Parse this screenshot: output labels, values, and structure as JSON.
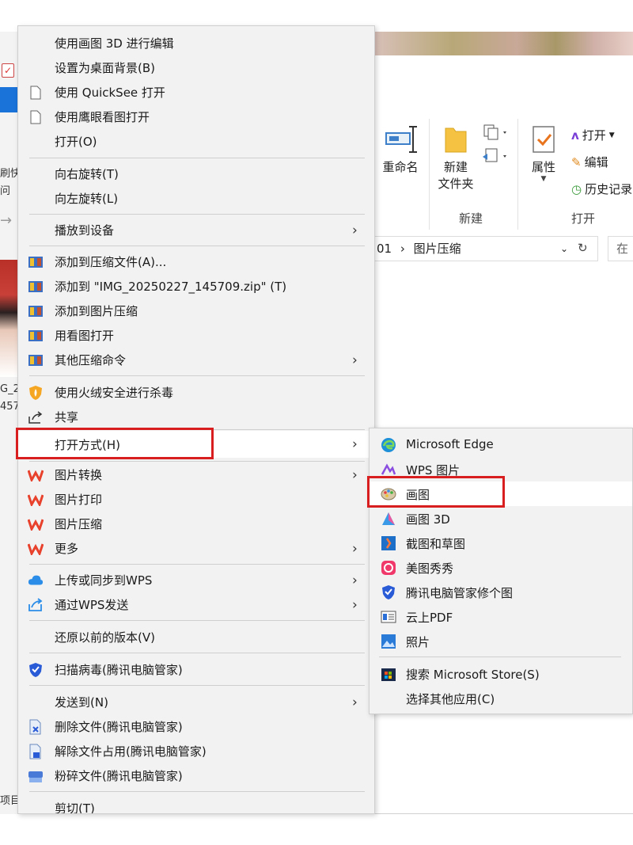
{
  "explorer": {
    "left_fragments": [
      "刷快",
      "问",
      "G_2",
      "457",
      "项目"
    ],
    "ribbon": {
      "rename": "重命名",
      "new_folder_line1": "新建",
      "new_folder_line2": "文件夹",
      "group_new": "新建",
      "properties": "属性",
      "open": "打开",
      "edit": "编辑",
      "history": "历史记录",
      "group_open": "打开"
    },
    "address": {
      "path_prefix": "01",
      "path_sep": "›",
      "path_current": "图片压缩",
      "search_placeholder": "在"
    }
  },
  "context_menu": {
    "items": [
      {
        "label": "使用画图 3D 进行编辑"
      },
      {
        "label": "设置为桌面背景(B)"
      },
      {
        "label": "使用 QuickSee 打开"
      },
      {
        "label": "使用鹰眼看图打开"
      },
      {
        "label": "打开(O)"
      },
      {
        "label": "向右旋转(T)"
      },
      {
        "label": "向左旋转(L)"
      },
      {
        "label": "播放到设备"
      },
      {
        "label": "添加到压缩文件(A)..."
      },
      {
        "label": "添加到 \"IMG_20250227_145709.zip\" (T)"
      },
      {
        "label": "添加到图片压缩"
      },
      {
        "label": "用看图打开"
      },
      {
        "label": "其他压缩命令"
      },
      {
        "label": "使用火绒安全进行杀毒"
      },
      {
        "label": "共享"
      },
      {
        "label": "打开方式(H)"
      },
      {
        "label": "图片转换"
      },
      {
        "label": "图片打印"
      },
      {
        "label": "图片压缩"
      },
      {
        "label": "更多"
      },
      {
        "label": "上传或同步到WPS"
      },
      {
        "label": "通过WPS发送"
      },
      {
        "label": "还原以前的版本(V)"
      },
      {
        "label": "扫描病毒(腾讯电脑管家)"
      },
      {
        "label": "发送到(N)"
      },
      {
        "label": "删除文件(腾讯电脑管家)"
      },
      {
        "label": "解除文件占用(腾讯电脑管家)"
      },
      {
        "label": "粉碎文件(腾讯电脑管家)"
      },
      {
        "label": "剪切(T)"
      }
    ]
  },
  "open_with_submenu": {
    "items": [
      {
        "label": "Microsoft Edge"
      },
      {
        "label": "WPS 图片"
      },
      {
        "label": "画图"
      },
      {
        "label": "画图 3D"
      },
      {
        "label": "截图和草图"
      },
      {
        "label": "美图秀秀"
      },
      {
        "label": "腾讯电脑管家修个图"
      },
      {
        "label": "云上PDF"
      },
      {
        "label": "照片"
      },
      {
        "label": "搜索 Microsoft Store(S)"
      },
      {
        "label": "选择其他应用(C)"
      }
    ]
  },
  "colors": {
    "highlight_box": "#d81e1e",
    "menu_bg": "#f2f2f2",
    "wps_red": "#e8412c",
    "selection_blue": "#1a73d9"
  }
}
